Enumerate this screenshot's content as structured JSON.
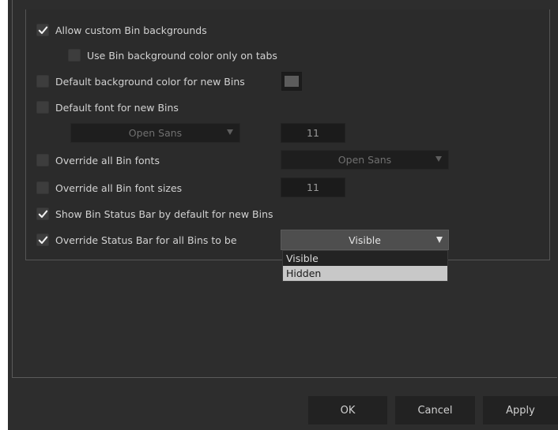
{
  "settings": {
    "allow_custom_bg": {
      "label": "Allow custom Bin backgrounds",
      "checked": true
    },
    "bg_only_on_tabs": {
      "label": "Use Bin background color only on tabs",
      "checked": false
    },
    "default_bg_color": {
      "label": "Default background color for new Bins",
      "checked": false
    },
    "default_font": {
      "label": "Default font for new Bins",
      "checked": false,
      "font_value": "Open Sans",
      "size_value": "11"
    },
    "override_fonts": {
      "label": "Override all Bin fonts",
      "checked": false,
      "font_value": "Open Sans"
    },
    "override_font_sizes": {
      "label": "Override all Bin font sizes",
      "checked": false,
      "size_value": "11"
    },
    "show_status_bar": {
      "label": "Show Bin Status Bar by default for new Bins",
      "checked": true
    },
    "override_status_bar": {
      "label": "Override Status Bar for all Bins to be",
      "checked": true,
      "selected": "Visible",
      "options": [
        "Visible",
        "Hidden"
      ],
      "highlighted": "Hidden"
    }
  },
  "buttons": {
    "ok": "OK",
    "cancel": "Cancel",
    "apply": "Apply"
  },
  "icons": {
    "check": "check-icon",
    "dropdown": "chevron-down-icon"
  }
}
